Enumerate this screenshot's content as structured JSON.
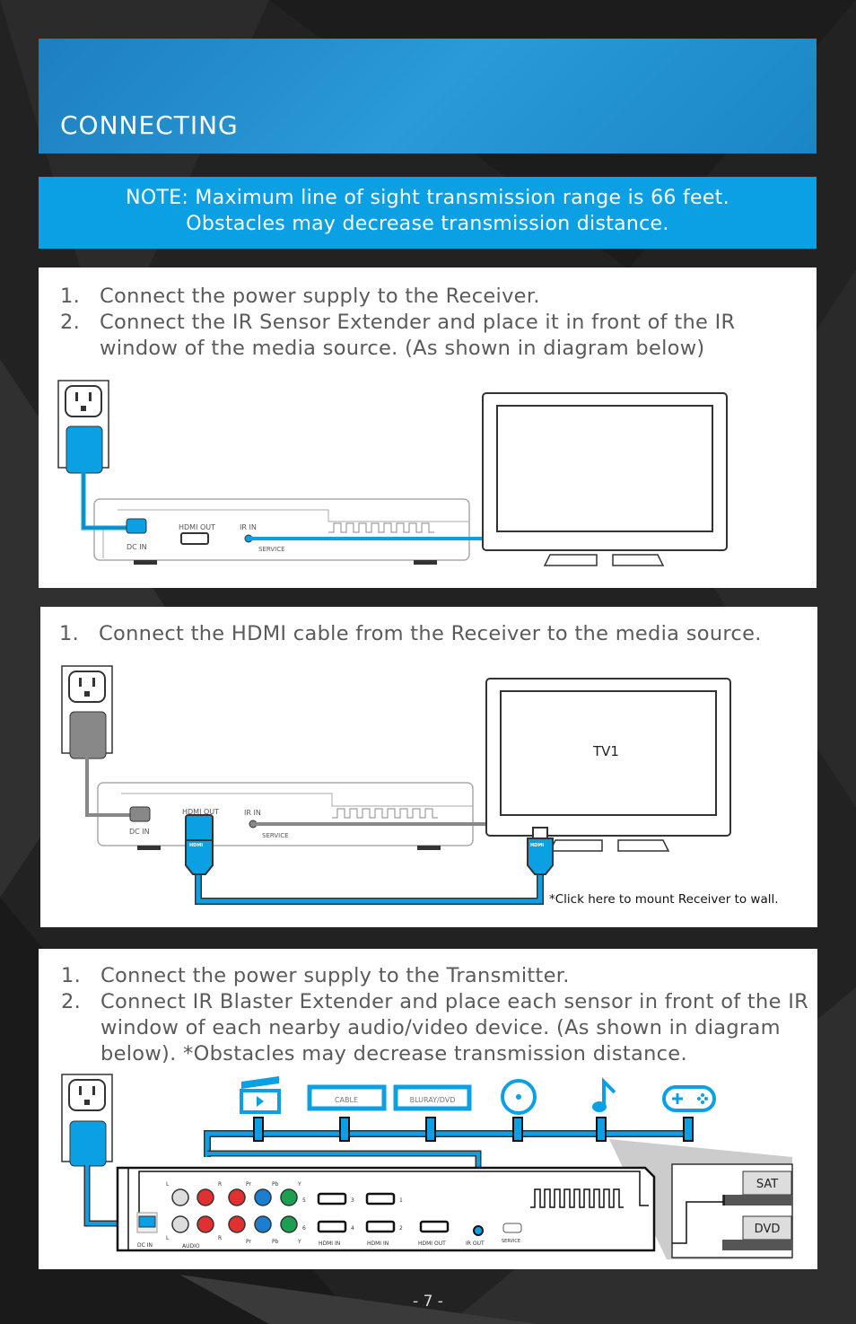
{
  "header": {
    "title": "CONNECTING"
  },
  "note": {
    "line1": "NOTE: Maximum line of sight transmission range is 66 feet.",
    "line2": "Obstacles may decrease transmission distance."
  },
  "section1": {
    "steps": [
      {
        "num": "1.",
        "text": "Connect the power supply to the Receiver."
      },
      {
        "num": "2.",
        "text": "Connect the IR Sensor Extender and place it in front of the IR window of the media source. (As shown in diagram below)"
      }
    ],
    "labels": {
      "hdmi_out": "HDMI OUT",
      "ir_in": "IR IN",
      "dc_in": "DC IN",
      "service": "SERVICE"
    }
  },
  "section2": {
    "steps": [
      {
        "num": "1.",
        "text": "Connect the HDMI cable from the Receiver to the media source."
      }
    ],
    "labels": {
      "hdmi_out": "HDMI OUT",
      "ir_in": "IR IN",
      "dc_in": "DC IN",
      "service": "SERVICE",
      "tv": "TV1",
      "hdmi_plug": "HDMI"
    },
    "mount_link": "*Click here to mount Receiver to wall."
  },
  "section3": {
    "steps": [
      {
        "num": "1.",
        "text": "Connect the power supply to the Transmitter."
      },
      {
        "num": "2.",
        "text": "Connect IR Blaster Extender and place each sensor in front of the IR window of each nearby audio/video device. (As shown in diagram below). *Obstacles may decrease transmission distance."
      }
    ],
    "devices": {
      "cable": "CABLE",
      "bluray": "BLURAY/DVD"
    },
    "labels": {
      "L": "L",
      "R": "R",
      "Pr": "Pr",
      "Pb": "Pb",
      "Y": "Y",
      "n1": "1",
      "n2": "2",
      "n3": "3",
      "n4": "4",
      "n5": "5",
      "n6": "6",
      "audio": "AUDIO",
      "hdmi_in": "HDMI IN",
      "hdmi_out": "HDMI OUT",
      "ir_out": "IR OUT",
      "service": "SERVICE",
      "dc_in": "DC IN",
      "sat": "SAT",
      "dvd": "DVD"
    }
  },
  "page_number": "- 7 -",
  "colors": {
    "accent": "#0aa0e3",
    "header": "#2a92d2",
    "text": "#5a5a5a"
  }
}
